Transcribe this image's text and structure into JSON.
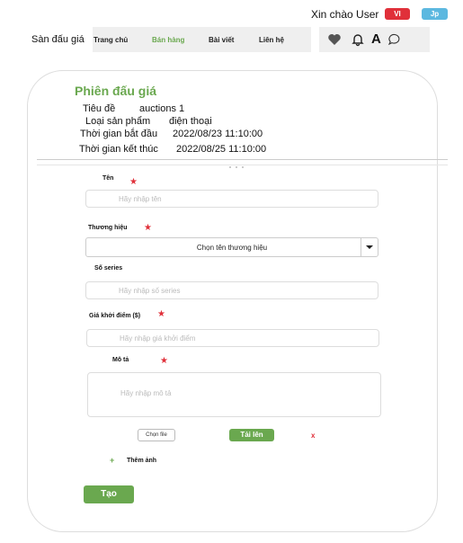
{
  "header": {
    "greeting": "Xin chào User",
    "lang_vi": "VI",
    "lang_jp": "Jp"
  },
  "nav": {
    "brand": "Sàn đấu giá",
    "links": [
      {
        "label": "Trang chủ",
        "active": false
      },
      {
        "label": "Bán hàng",
        "active": true
      },
      {
        "label": "Bài viết",
        "active": false
      },
      {
        "label": "Liên hệ",
        "active": false
      }
    ],
    "icons": [
      "heart-icon",
      "bell-icon",
      "font-icon",
      "chat-icon"
    ],
    "font_icon_glyph": "A"
  },
  "auction": {
    "title": "Phiên đấu giá",
    "fields": [
      {
        "label": "Tiêu đề",
        "value": "auctions 1"
      },
      {
        "label": "Loại sản phẩm",
        "value": "điện thoại"
      },
      {
        "label": "Thời gian bắt đầu",
        "value": "2022/08/23 11:10:00"
      },
      {
        "label": "Thời gian kết thúc",
        "value": "2022/08/25 11:10:00"
      }
    ]
  },
  "form": {
    "name": {
      "label": "Tên",
      "placeholder": "Hãy nhập tên"
    },
    "brand": {
      "label": "Thương hiệu",
      "selected": "Chọn tên thương hiệu"
    },
    "serial": {
      "label": "Số series",
      "placeholder": "Hãy nhập số series"
    },
    "start_price": {
      "label": "Giá khởi điểm ($)",
      "placeholder": "Hãy nhập giá khởi điểm"
    },
    "description": {
      "label": "Mô tả",
      "placeholder": "Hãy nhập mô tả"
    },
    "required_mark": "★",
    "choose_file": "Chọn file",
    "upload": "Tải lên",
    "remove": "x",
    "add_image_plus": "+",
    "add_image": "Thêm ảnh",
    "submit": "Tạo"
  },
  "colors": {
    "accent": "#6aa84f",
    "danger": "#e0303a",
    "lang_jp": "#5cb8e0"
  }
}
